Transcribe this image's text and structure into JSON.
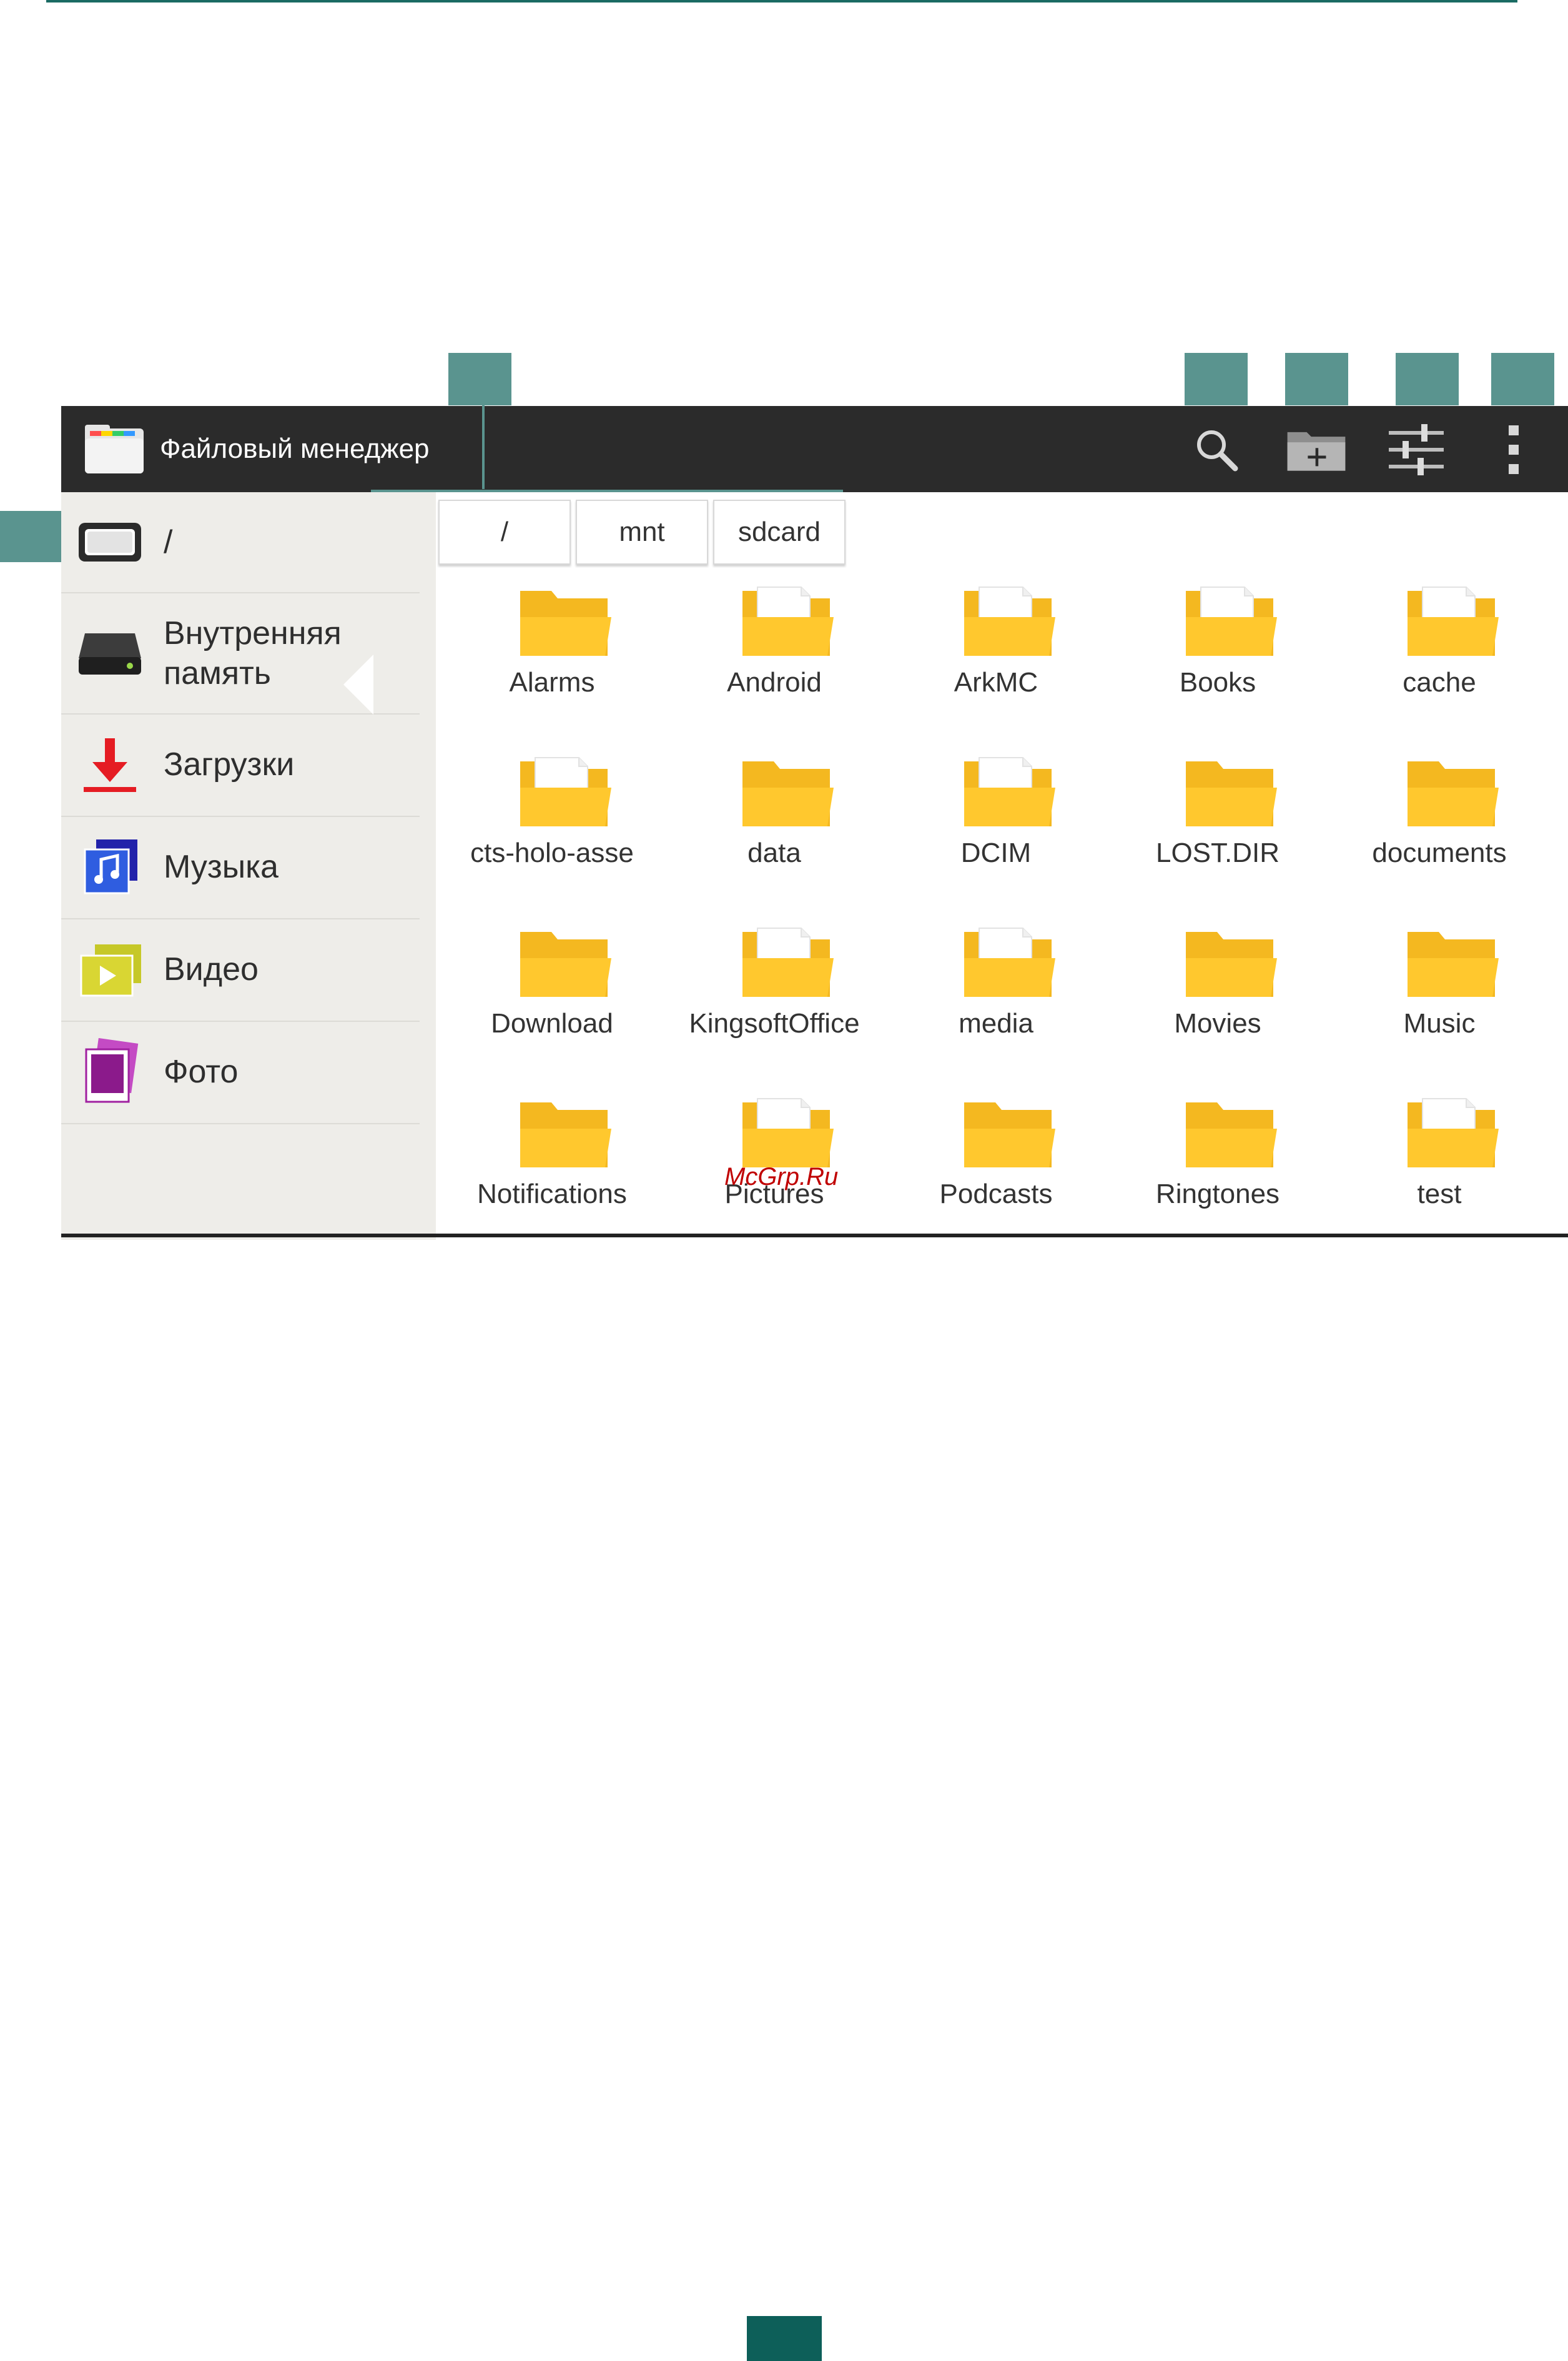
{
  "app": {
    "title": "Файловый менеджер"
  },
  "toolbar": {
    "search_icon": "search-icon",
    "new_folder_icon": "new-folder-icon",
    "settings_icon": "sliders-icon",
    "overflow_icon": "overflow-menu-icon"
  },
  "sidebar": {
    "items": [
      {
        "label": "/",
        "icon": "root-drive-icon"
      },
      {
        "label": "Внутренняя память",
        "icon": "internal-storage-icon"
      },
      {
        "label": "Загрузки",
        "icon": "download-icon"
      },
      {
        "label": "Музыка",
        "icon": "music-icon"
      },
      {
        "label": "Видео",
        "icon": "video-icon"
      },
      {
        "label": "Фото",
        "icon": "photo-icon"
      }
    ]
  },
  "breadcrumb": [
    "/",
    "mnt",
    "sdcard"
  ],
  "folders": [
    {
      "name": "Alarms",
      "has_content": false
    },
    {
      "name": "Android",
      "has_content": true
    },
    {
      "name": "ArkMC",
      "has_content": true
    },
    {
      "name": "Books",
      "has_content": true
    },
    {
      "name": "cache",
      "has_content": true
    },
    {
      "name": "cts-holo-asse",
      "has_content": true
    },
    {
      "name": "data",
      "has_content": false
    },
    {
      "name": "DCIM",
      "has_content": true
    },
    {
      "name": "LOST.DIR",
      "has_content": false
    },
    {
      "name": "documents",
      "has_content": false
    },
    {
      "name": "Download",
      "has_content": false
    },
    {
      "name": "KingsoftOffice",
      "has_content": true
    },
    {
      "name": "media",
      "has_content": true
    },
    {
      "name": "Movies",
      "has_content": false
    },
    {
      "name": "Music",
      "has_content": false
    },
    {
      "name": "Notifications",
      "has_content": false
    },
    {
      "name": "Pictures",
      "has_content": true
    },
    {
      "name": "Podcasts",
      "has_content": false
    },
    {
      "name": "Ringtones",
      "has_content": false
    },
    {
      "name": "test",
      "has_content": true
    }
  ],
  "watermark": "McGrp.Ru",
  "colors": {
    "accent": "#5a948f",
    "folder": "#ffc82e",
    "folder_dark": "#f4b820",
    "actionbar": "#2b2b2b"
  }
}
